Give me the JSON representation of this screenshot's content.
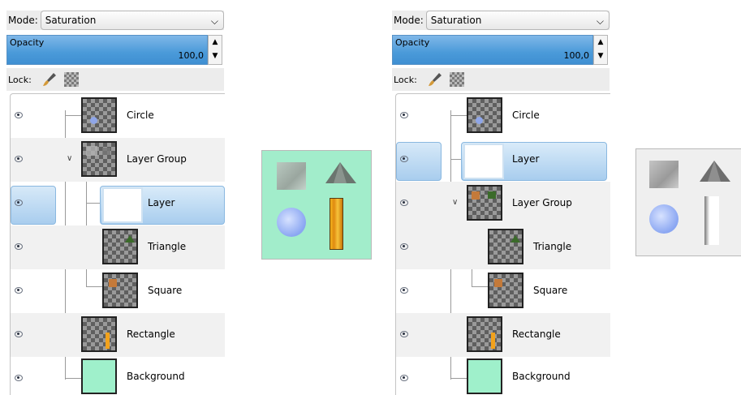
{
  "panels": [
    {
      "mode_label": "Mode:",
      "mode_value": "Saturation",
      "opacity_label": "Opacity",
      "opacity_value": "100,0",
      "lock_label": "Lock:",
      "layers": [
        {
          "name": "Circle"
        },
        {
          "name": "Layer Group",
          "expanded": true
        },
        {
          "name": "Layer",
          "selected": true
        },
        {
          "name": "Triangle"
        },
        {
          "name": "Square"
        },
        {
          "name": "Rectangle"
        },
        {
          "name": "Background"
        }
      ]
    },
    {
      "mode_label": "Mode:",
      "mode_value": "Saturation",
      "opacity_label": "Opacity",
      "opacity_value": "100,0",
      "lock_label": "Lock:",
      "layers": [
        {
          "name": "Circle"
        },
        {
          "name": "Layer",
          "selected": true
        },
        {
          "name": "Layer Group",
          "expanded": true
        },
        {
          "name": "Triangle"
        },
        {
          "name": "Square"
        },
        {
          "name": "Rectangle"
        },
        {
          "name": "Background"
        }
      ]
    }
  ],
  "colors": {
    "selection": "#a9cdee",
    "background_layer": "#9ff0cb",
    "preview_left_bg": "#a2edcb",
    "preview_right_bg": "#efefef"
  },
  "icons": [
    "eye-icon",
    "brush-icon",
    "alpha-lock-icon",
    "chevron-down-icon",
    "spin-arrows-icon",
    "expander-icon"
  ]
}
